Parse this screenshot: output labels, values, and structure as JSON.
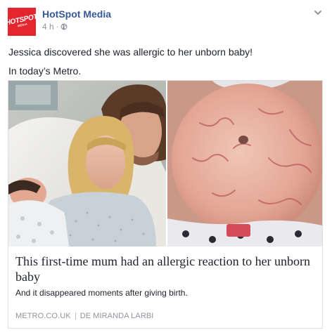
{
  "post": {
    "page_name": "HotSpot Media",
    "timestamp": "4 h",
    "separator": "·",
    "privacy_icon": "globe-icon",
    "menu_icon": "chevron-down-icon",
    "avatar": {
      "logo_text": "HOTSPOT",
      "logo_subtext": "MEDIA",
      "color": "#e3262e"
    },
    "lines": [
      "Jessica discovered she was allergic to her unborn baby!",
      "In today’s Metro."
    ]
  },
  "link_card": {
    "title": "This first-time mum had an allergic reaction to her unborn baby",
    "description": "And it disappeared moments after giving birth.",
    "source": "METRO.CO.UK",
    "author_prefix": "DE",
    "author": "MIRANDA LARBI"
  },
  "colors": {
    "link_blue": "#365899",
    "muted_gray": "#90949c",
    "text": "#1d2129",
    "border": "#dddfe2"
  }
}
